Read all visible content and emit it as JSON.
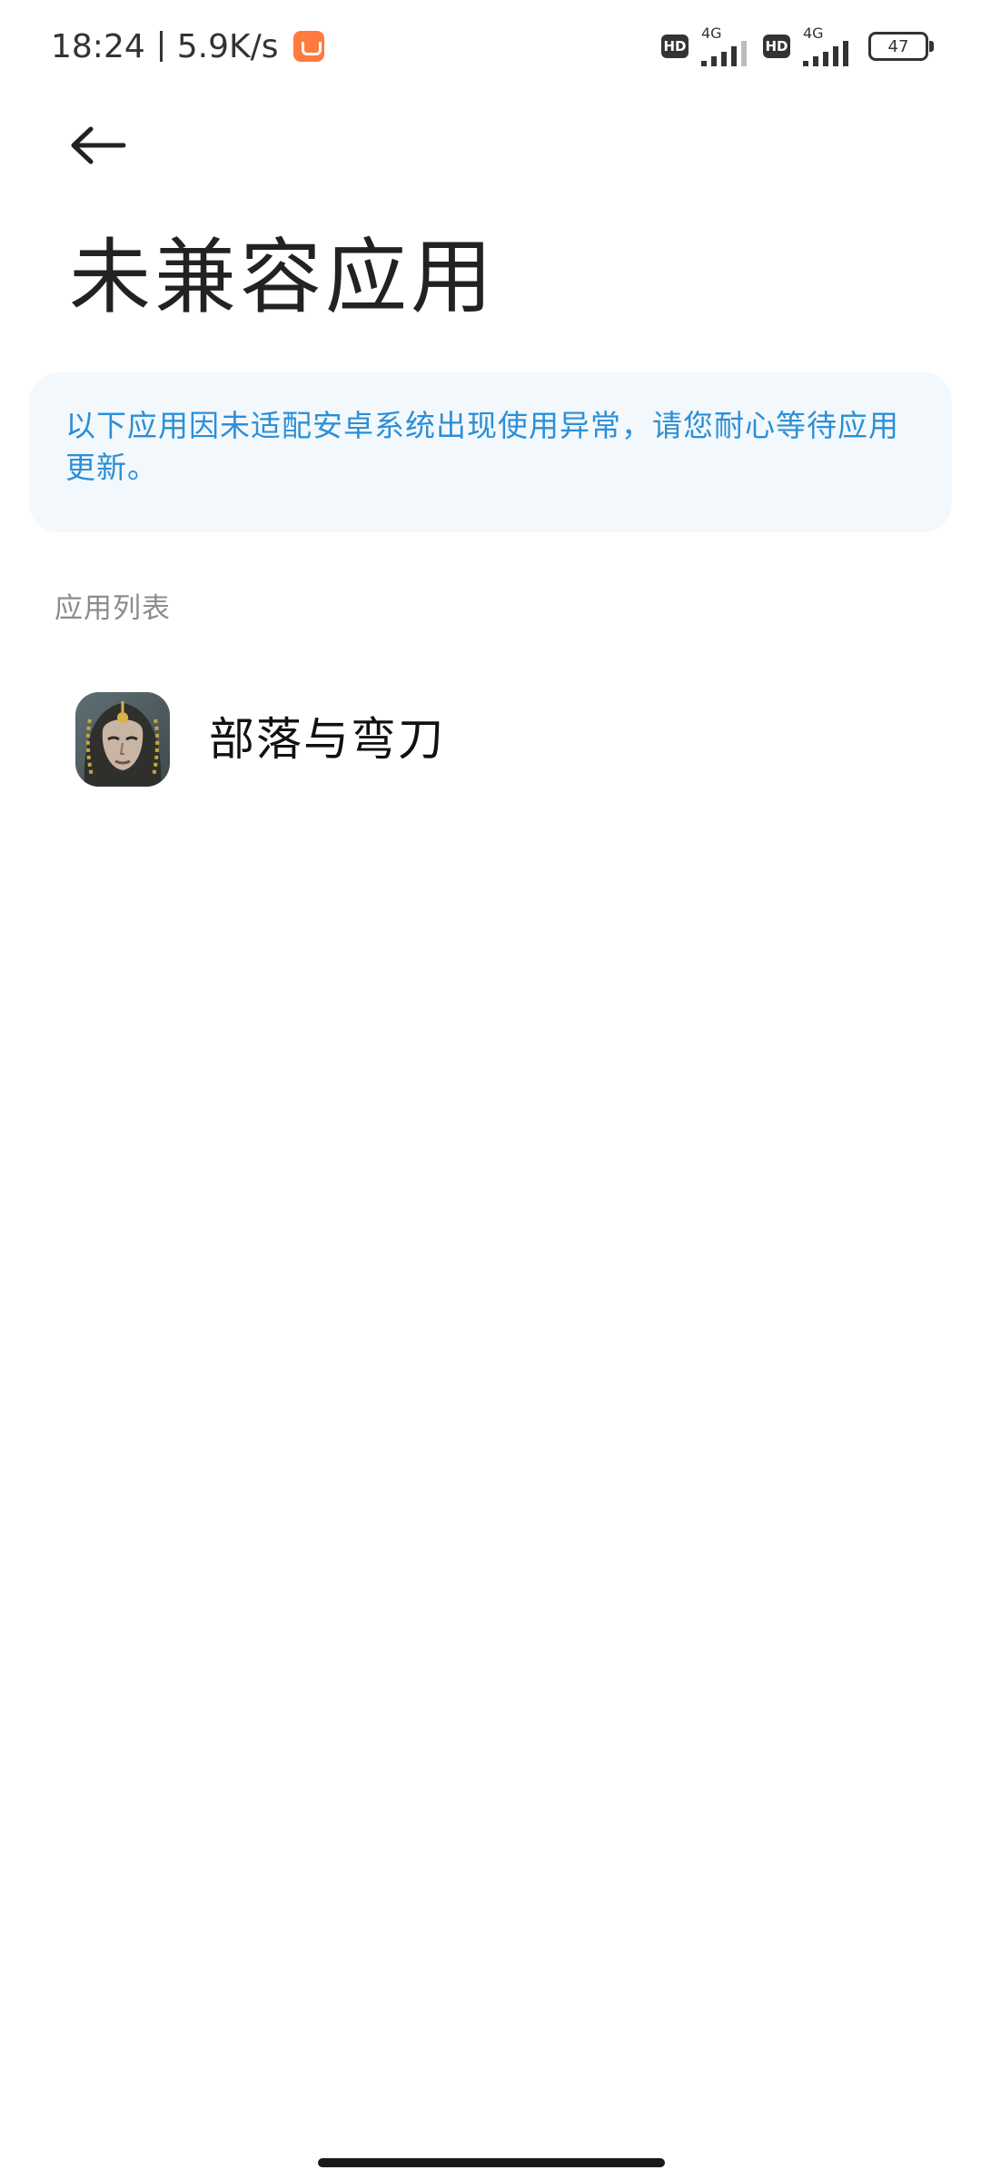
{
  "status_bar": {
    "time": "18:24",
    "net_speed": "5.9K/s",
    "store_icon": "app-store-icon",
    "sim1": {
      "badge": "HD",
      "network": "4G"
    },
    "sim2": {
      "badge": "HD",
      "network": "4G"
    },
    "battery": "47"
  },
  "header": {
    "back_icon": "arrow-left-icon",
    "title": "未兼容应用"
  },
  "notice": {
    "text": "以下应用因未适配安卓系统出现使用异常，请您耐心等待应用更新。"
  },
  "section": {
    "label": "应用列表"
  },
  "apps": [
    {
      "name": "部落与弯刀",
      "icon": "tribes-and-scimitars-app-icon"
    }
  ],
  "colors": {
    "notice_bg": "#f3f8fd",
    "notice_text": "#2c8fd6",
    "section_label": "#8c8c8c",
    "store_icon": "#ff7a3d"
  }
}
